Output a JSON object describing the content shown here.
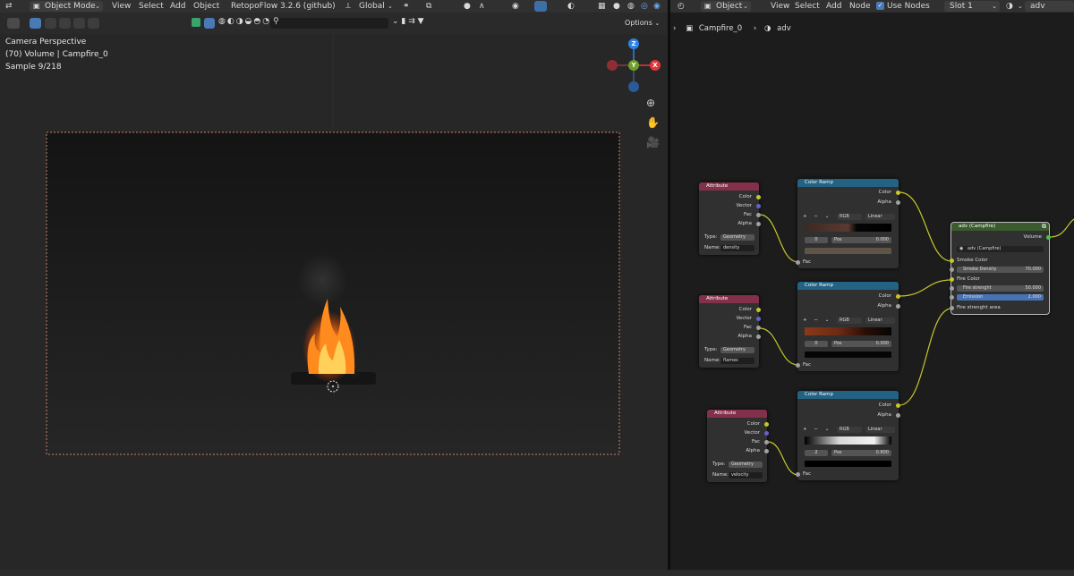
{
  "viewport_header": {
    "mode": "Object Mode",
    "menu": [
      "View",
      "Select",
      "Add",
      "Object"
    ],
    "addon": "RetopoFlow 3.2.6 (github)",
    "orientation": "Global",
    "options": "Options"
  },
  "viewport_overlay": {
    "line1": "Camera Perspective",
    "line2": "(70) Volume | Campfire_0",
    "line3": "Sample 9/218"
  },
  "gizmo": {
    "z": "Z",
    "y": "Y",
    "x": "X"
  },
  "node_header": {
    "type": "Object",
    "menu": [
      "View",
      "Select",
      "Add",
      "Node"
    ],
    "use_nodes": "Use Nodes",
    "slot": "Slot 1",
    "material": "adv"
  },
  "breadcrumb": {
    "object": "Campfire_0",
    "material": "adv"
  },
  "nodes": {
    "attr1": {
      "title": "Attribute",
      "outputs": [
        "Color",
        "Vector",
        "Fac",
        "Alpha"
      ],
      "type_label": "Type:",
      "type_value": "Geometry",
      "name_label": "Name:",
      "name_value": "density"
    },
    "attr2": {
      "title": "Attribute",
      "outputs": [
        "Color",
        "Vector",
        "Fac",
        "Alpha"
      ],
      "type_label": "Type:",
      "type_value": "Geometry",
      "name_label": "Name:",
      "name_value": "flames"
    },
    "attr3": {
      "title": "Attribute",
      "outputs": [
        "Color",
        "Vector",
        "Fac",
        "Alpha"
      ],
      "type_label": "Type:",
      "type_value": "Geometry",
      "name_label": "Name:",
      "name_value": "velocity"
    },
    "ramp1": {
      "title": "Color Ramp",
      "outputs": [
        "Color",
        "Alpha"
      ],
      "mode": "RGB",
      "interp": "Linear",
      "index": "0",
      "pos_label": "Pos",
      "pos_value": "0.000",
      "input": "Fac"
    },
    "ramp2": {
      "title": "Color Ramp",
      "outputs": [
        "Color",
        "Alpha"
      ],
      "mode": "RGB",
      "interp": "Linear",
      "index": "0",
      "pos_label": "Pos",
      "pos_value": "0.000",
      "input": "Fac"
    },
    "ramp3": {
      "title": "Color Ramp",
      "outputs": [
        "Color",
        "Alpha"
      ],
      "mode": "RGB",
      "interp": "Linear",
      "index": "2",
      "pos_label": "Pos",
      "pos_value": "0.800",
      "input": "Fac"
    },
    "group": {
      "title": "adv (Campfire)",
      "output": "Volume",
      "selector": "adv (Campfire)",
      "smoke_color": "Smoke Color",
      "smoke_density_label": "Smoke Density",
      "smoke_density": "70.000",
      "fire_color": "Fire Color",
      "fire_strength_label": "Fire strenght",
      "fire_strength": "50.000",
      "emission_label": "Emission",
      "emission": "2.000",
      "fire_area": "Fire strenght area"
    }
  },
  "colors": {
    "attribute_header": "#83314a",
    "colorramp_header": "#246283",
    "group_header": "#3b5b2e",
    "socket_yellow": "#c7c729",
    "socket_purple": "#6363c7",
    "socket_gray": "#a1a1a1",
    "gizmo_x": "#e0383e",
    "gizmo_y": "#6ea02b",
    "gizmo_z": "#2f83e3"
  }
}
